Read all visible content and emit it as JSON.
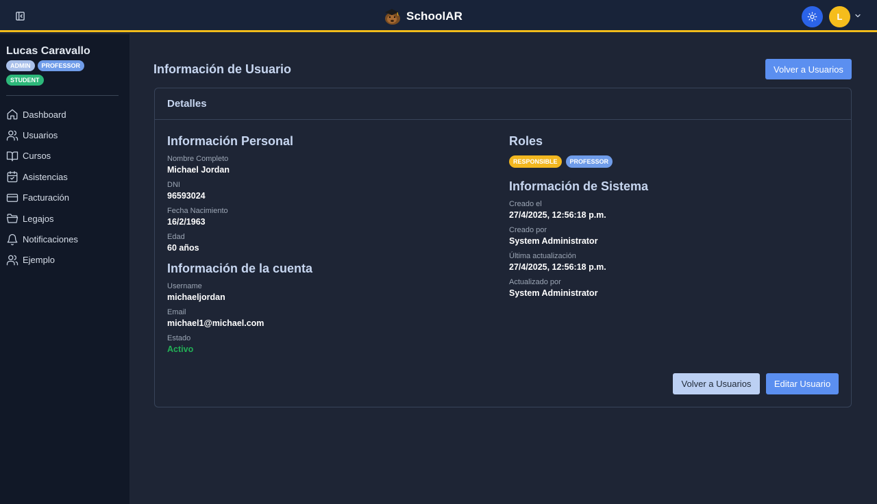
{
  "header": {
    "app_name": "SchoolAR",
    "avatar_initial": "L",
    "icons": {
      "sidebar_toggle": "panel-left-icon",
      "theme": "sun-icon",
      "chevron": "chevron-down-icon"
    },
    "colors": {
      "accent": "#f2bc1b",
      "theme_button": "#2b63e8",
      "avatar": "#f5bd1c"
    }
  },
  "sidebar": {
    "user_name": "Lucas Caravallo",
    "roles": [
      "ADMIN",
      "PROFESSOR",
      "STUDENT"
    ],
    "items": [
      {
        "label": "Dashboard",
        "icon": "home-icon"
      },
      {
        "label": "Usuarios",
        "icon": "users-icon"
      },
      {
        "label": "Cursos",
        "icon": "book-icon"
      },
      {
        "label": "Asistencias",
        "icon": "calendar-check-icon"
      },
      {
        "label": "Facturación",
        "icon": "credit-card-icon"
      },
      {
        "label": "Legajos",
        "icon": "folder-icon"
      },
      {
        "label": "Notificaciones",
        "icon": "bell-icon"
      },
      {
        "label": "Ejemplo",
        "icon": "users-icon"
      }
    ]
  },
  "main": {
    "title": "Información de Usuario",
    "back_button": "Volver a Usuarios",
    "card": {
      "header": "Detalles",
      "personal": {
        "title": "Información Personal",
        "fields": [
          {
            "label": "Nombre Completo",
            "value": "Michael Jordan"
          },
          {
            "label": "DNI",
            "value": "96593024"
          },
          {
            "label": "Fecha Nacimiento",
            "value": "16/2/1963"
          },
          {
            "label": "Edad",
            "value": "60 años"
          }
        ]
      },
      "account": {
        "title": "Información de la cuenta",
        "fields": [
          {
            "label": "Username",
            "value": "michaeljordan"
          },
          {
            "label": "Email",
            "value": "michael1@michael.com"
          },
          {
            "label": "Estado",
            "value": "Activo"
          }
        ]
      },
      "roles": {
        "title": "Roles",
        "items": [
          "RESPONSIBLE",
          "PROFESSOR"
        ]
      },
      "system": {
        "title": "Información de Sistema",
        "fields": [
          {
            "label": "Creado el",
            "value": "27/4/2025, 12:56:18 p.m."
          },
          {
            "label": "Creado por",
            "value": "System Administrator"
          },
          {
            "label": "Última actualización",
            "value": "27/4/2025, 12:56:18 p.m."
          },
          {
            "label": "Actualizado por",
            "value": "System Administrator"
          }
        ]
      },
      "actions": {
        "back": "Volver a Usuarios",
        "edit": "Editar Usuario"
      }
    }
  }
}
